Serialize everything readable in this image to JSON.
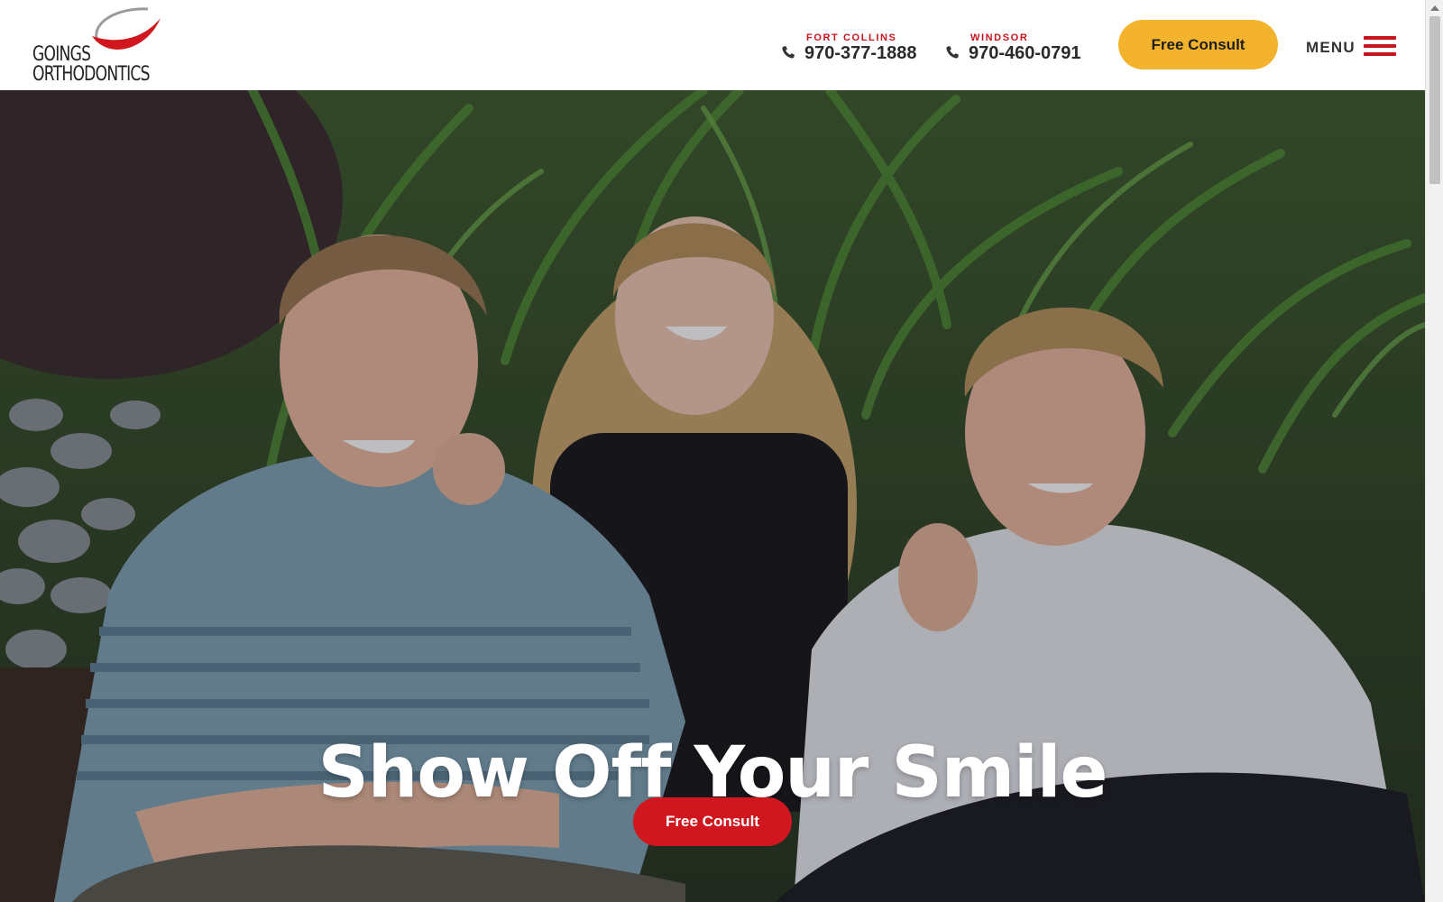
{
  "header": {
    "logo": {
      "line1": "GOINGS",
      "line2": "ORTHODONTICS",
      "swoosh_color": "#d0161e",
      "arc_color": "#9a9a9a"
    },
    "phones": [
      {
        "location": "FORT COLLINS",
        "number": "970-377-1888",
        "icon": "phone-icon"
      },
      {
        "location": "WINDSOR",
        "number": "970-460-0791",
        "icon": "phone-icon"
      }
    ],
    "consult_button": "Free Consult",
    "menu_label": "MENU",
    "menu_icon": "hamburger-icon"
  },
  "hero": {
    "title": "Show Off Your Smile",
    "button": "Free Consult"
  },
  "colors": {
    "accent_red": "#d0161e",
    "accent_yellow": "#f3b32c",
    "text_dark": "#2a2a2a"
  }
}
